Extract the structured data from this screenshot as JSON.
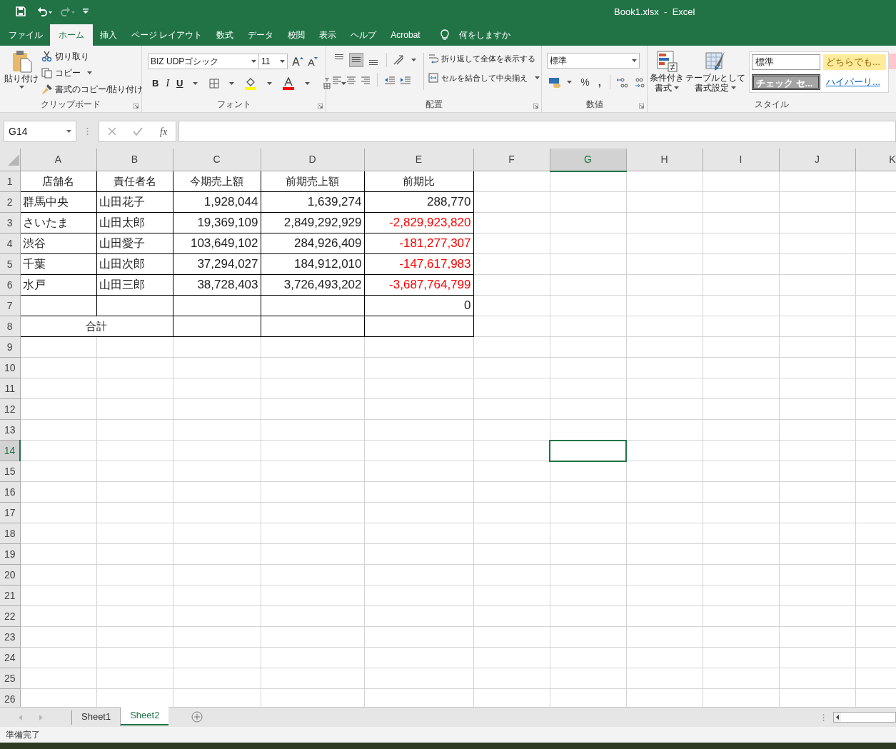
{
  "window": {
    "title": "Book1.xlsx  -  Excel"
  },
  "ribbon_tabs": [
    {
      "label": "ファイル",
      "selected": false
    },
    {
      "label": "ホーム",
      "selected": true
    },
    {
      "label": "挿入",
      "selected": false
    },
    {
      "label": "ページ レイアウト",
      "selected": false
    },
    {
      "label": "数式",
      "selected": false
    },
    {
      "label": "データ",
      "selected": false
    },
    {
      "label": "校閲",
      "selected": false
    },
    {
      "label": "表示",
      "selected": false
    },
    {
      "label": "ヘルプ",
      "selected": false
    },
    {
      "label": "Acrobat",
      "selected": false
    }
  ],
  "tell_me": "何をしますか",
  "clipboard": {
    "paste": "貼り付け",
    "cut": "切り取り",
    "copy": "コピー",
    "format_painter": "書式のコピー/貼り付け",
    "label": "クリップボード"
  },
  "font": {
    "name": "BIZ UDPゴシック",
    "size": "11",
    "bold": "B",
    "italic": "I",
    "underline": "U",
    "label": "フォント"
  },
  "alignment": {
    "vertical": [
      {
        "kind": "top",
        "selected": false
      },
      {
        "kind": "middle",
        "selected": true
      },
      {
        "kind": "bottom",
        "selected": false
      }
    ],
    "wrap": "折り返して全体を表示する",
    "merge": "セルを結合して中央揃え",
    "label": "配置"
  },
  "number": {
    "format": "標準",
    "percent": "%",
    "comma": ",",
    "label": "数値"
  },
  "styles": {
    "conditional": [
      "条件付き",
      "書式"
    ],
    "table": [
      "テーブルとして",
      "書式設定"
    ],
    "gallery": [
      {
        "kind": "normal",
        "label": "標準"
      },
      {
        "kind": "neutral",
        "label": "どちらでも..."
      },
      {
        "kind": "check",
        "label": "チェック セ..."
      },
      {
        "kind": "hyperlink",
        "label": "ハイパーリ..."
      }
    ],
    "label": "スタイル"
  },
  "formula_bar": {
    "name_box": "G14",
    "fx": "fx"
  },
  "column_headers": [
    {
      "label": "A",
      "selected": false
    },
    {
      "label": "B",
      "selected": false
    },
    {
      "label": "C",
      "selected": false
    },
    {
      "label": "D",
      "selected": false
    },
    {
      "label": "E",
      "selected": false
    },
    {
      "label": "F",
      "selected": false
    },
    {
      "label": "G",
      "selected": true
    },
    {
      "label": "H",
      "selected": false
    },
    {
      "label": "I",
      "selected": false
    },
    {
      "label": "J",
      "selected": false
    },
    {
      "label": "K",
      "selected": false
    }
  ],
  "row_headers": [
    {
      "label": "1",
      "selected": false
    },
    {
      "label": "2",
      "selected": false
    },
    {
      "label": "3",
      "selected": false
    },
    {
      "label": "4",
      "selected": false
    },
    {
      "label": "5",
      "selected": false
    },
    {
      "label": "6",
      "selected": false
    },
    {
      "label": "7",
      "selected": false
    },
    {
      "label": "8",
      "selected": false
    },
    {
      "label": "9",
      "selected": false
    },
    {
      "label": "10",
      "selected": false
    },
    {
      "label": "11",
      "selected": false
    },
    {
      "label": "12",
      "selected": false
    },
    {
      "label": "13",
      "selected": false
    },
    {
      "label": "14",
      "selected": true
    },
    {
      "label": "15",
      "selected": false
    },
    {
      "label": "16",
      "selected": false
    },
    {
      "label": "17",
      "selected": false
    },
    {
      "label": "18",
      "selected": false
    },
    {
      "label": "19",
      "selected": false
    },
    {
      "label": "20",
      "selected": false
    },
    {
      "label": "21",
      "selected": false
    },
    {
      "label": "22",
      "selected": false
    },
    {
      "label": "23",
      "selected": false
    },
    {
      "label": "24",
      "selected": false
    },
    {
      "label": "25",
      "selected": false
    },
    {
      "label": "26",
      "selected": false
    }
  ],
  "table_rows": [
    {
      "kind": "header",
      "cells": [
        "店舗名",
        "責任者名",
        "今期売上額",
        "前期売上額",
        "前期比"
      ]
    },
    {
      "kind": "data",
      "cells": [
        "群馬中央",
        "山田花子",
        "1,928,044",
        "1,639,274",
        "288,770"
      ],
      "negative": false
    },
    {
      "kind": "data",
      "cells": [
        "さいたま",
        "山田太郎",
        "19,369,109",
        "2,849,292,929",
        "-2,829,923,820"
      ],
      "negative": true
    },
    {
      "kind": "data",
      "cells": [
        "渋谷",
        "山田愛子",
        "103,649,102",
        "284,926,409",
        "-181,277,307"
      ],
      "negative": true
    },
    {
      "kind": "data",
      "cells": [
        "千葉",
        "山田次郎",
        "37,294,027",
        "184,912,010",
        "-147,617,983"
      ],
      "negative": true
    },
    {
      "kind": "data",
      "cells": [
        "水戸",
        "山田三郎",
        "38,728,403",
        "3,726,493,202",
        "-3,687,764,799"
      ],
      "negative": true
    },
    {
      "kind": "data",
      "cells": [
        null,
        null,
        null,
        null,
        "0"
      ],
      "negative": false
    },
    {
      "kind": "total",
      "label": "合計"
    }
  ],
  "sheet_tabs": [
    {
      "label": "Sheet1",
      "selected": false
    },
    {
      "label": "Sheet2",
      "selected": true
    }
  ],
  "status_bar": "準備完了"
}
